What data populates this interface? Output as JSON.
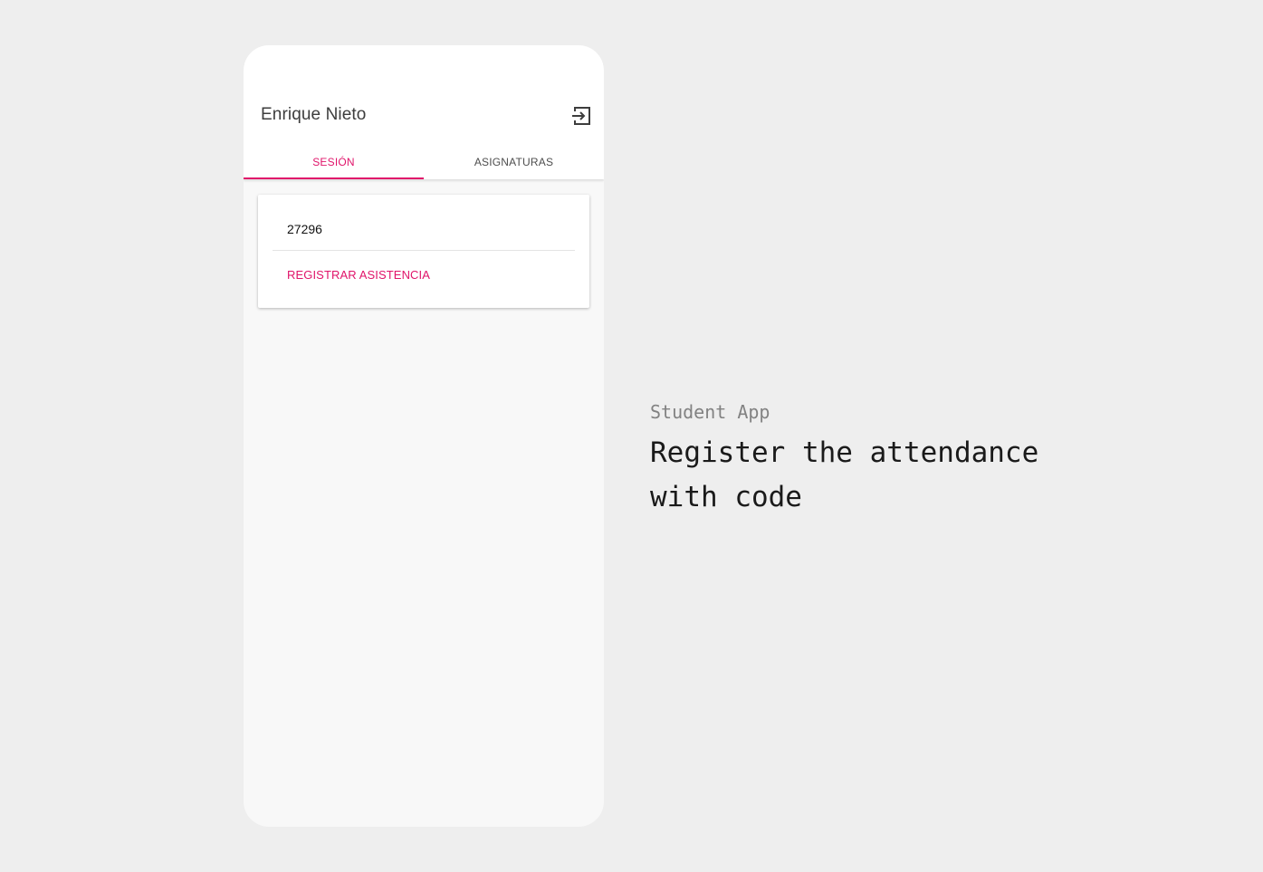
{
  "app": {
    "user_name": "Enrique Nieto",
    "logout_icon": "logout-icon",
    "tabs": [
      {
        "label": "SESIÓN",
        "active": true
      },
      {
        "label": "ASIGNATURAS",
        "active": false
      }
    ],
    "code_field": {
      "value": "27296"
    },
    "register_button": "REGISTRAR ASISTENCIA"
  },
  "caption": {
    "subtitle": "Student App",
    "title": "Register the attendance with code"
  },
  "colors": {
    "accent": "#e0146a",
    "background": "#eeeeee",
    "app_background": "#f8f8f8"
  }
}
